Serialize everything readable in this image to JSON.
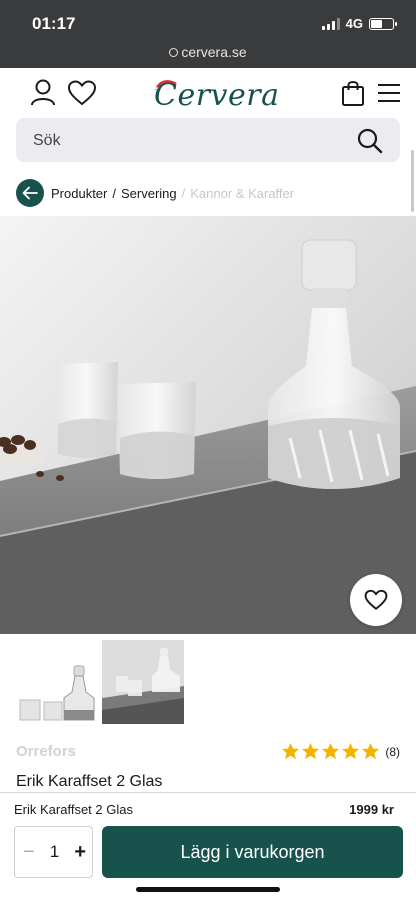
{
  "status_bar": {
    "time": "01:17",
    "network": "4G",
    "battery_level": 0.5
  },
  "browser": {
    "url": "cervera.se"
  },
  "header": {
    "logo": "Cervera"
  },
  "search": {
    "placeholder": "Sök"
  },
  "breadcrumb": {
    "items": [
      {
        "label": "Produkter"
      },
      {
        "label": "Servering"
      }
    ],
    "current": "Kannor & Karaffer"
  },
  "product": {
    "brand": "Orrefors",
    "rating": 5,
    "rating_count": "(8)",
    "title": "Erik Karaffset 2 Glas",
    "price": "1999 kr"
  },
  "cart_bar": {
    "product_name": "Erik Karaffset 2 Glas",
    "price": "1999 kr",
    "quantity": "1",
    "minus": "−",
    "plus": "+",
    "add_label": "Lägg i varukorgen"
  },
  "colors": {
    "brand": "#17524d",
    "star": "#f5b301",
    "hat": "#d23434"
  },
  "icons": [
    "user-icon",
    "heart-icon",
    "bag-icon",
    "menu-icon",
    "search-icon",
    "arrow-left-icon",
    "star-icon"
  ]
}
